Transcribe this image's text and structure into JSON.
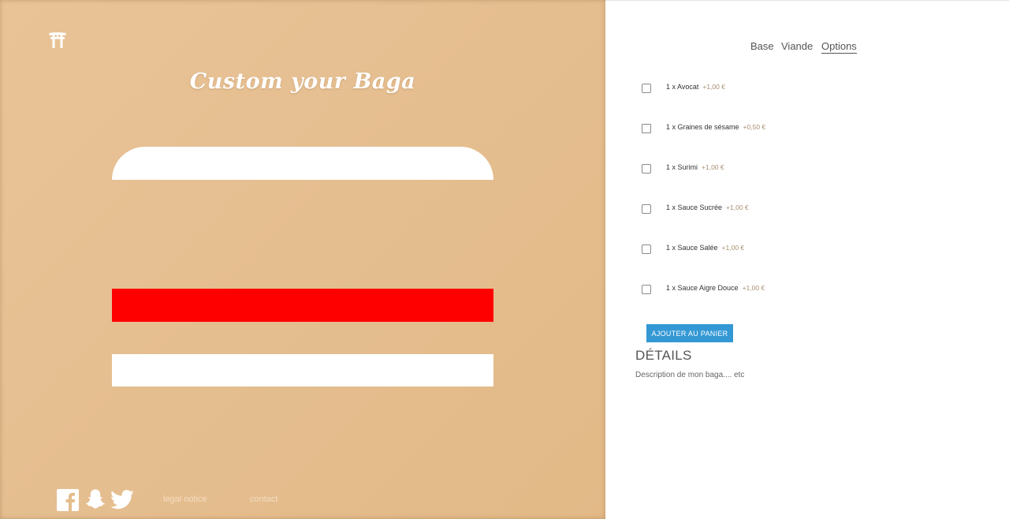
{
  "hero": {
    "title": "Custom your Baga"
  },
  "layers": {
    "bun_color": "#ffffff",
    "filling_color": "#ff0000",
    "background_color": "#e6bf91"
  },
  "footer": {
    "social_icons": [
      "facebook-icon",
      "snapchat-icon",
      "twitter-icon"
    ],
    "legal_label": "legal notice",
    "contact_label": "contact"
  },
  "tabs": [
    {
      "label": "Base",
      "active": false
    },
    {
      "label": "Viande",
      "active": false
    },
    {
      "label": "Options",
      "active": true
    }
  ],
  "options": [
    {
      "label": "1 x Avocat",
      "price": "+1,00 €",
      "checked": false
    },
    {
      "label": "1 x Graines de sésame",
      "price": "+0,50 €",
      "checked": false
    },
    {
      "label": "1 x Surimi",
      "price": "+1,00 €",
      "checked": false
    },
    {
      "label": "1 x Sauce Sucrée",
      "price": "+1,00 €",
      "checked": false
    },
    {
      "label": "1 x Sauce Salée",
      "price": "+1,00 €",
      "checked": false
    },
    {
      "label": "1 x Sauce Aigre Douce",
      "price": "+1,00 €",
      "checked": false
    }
  ],
  "cart": {
    "button_label": "AJOUTER AU PANIER",
    "button_color": "#3498d5"
  },
  "details": {
    "title": "DÉTAILS",
    "description": "Description de mon baga.... etc"
  }
}
